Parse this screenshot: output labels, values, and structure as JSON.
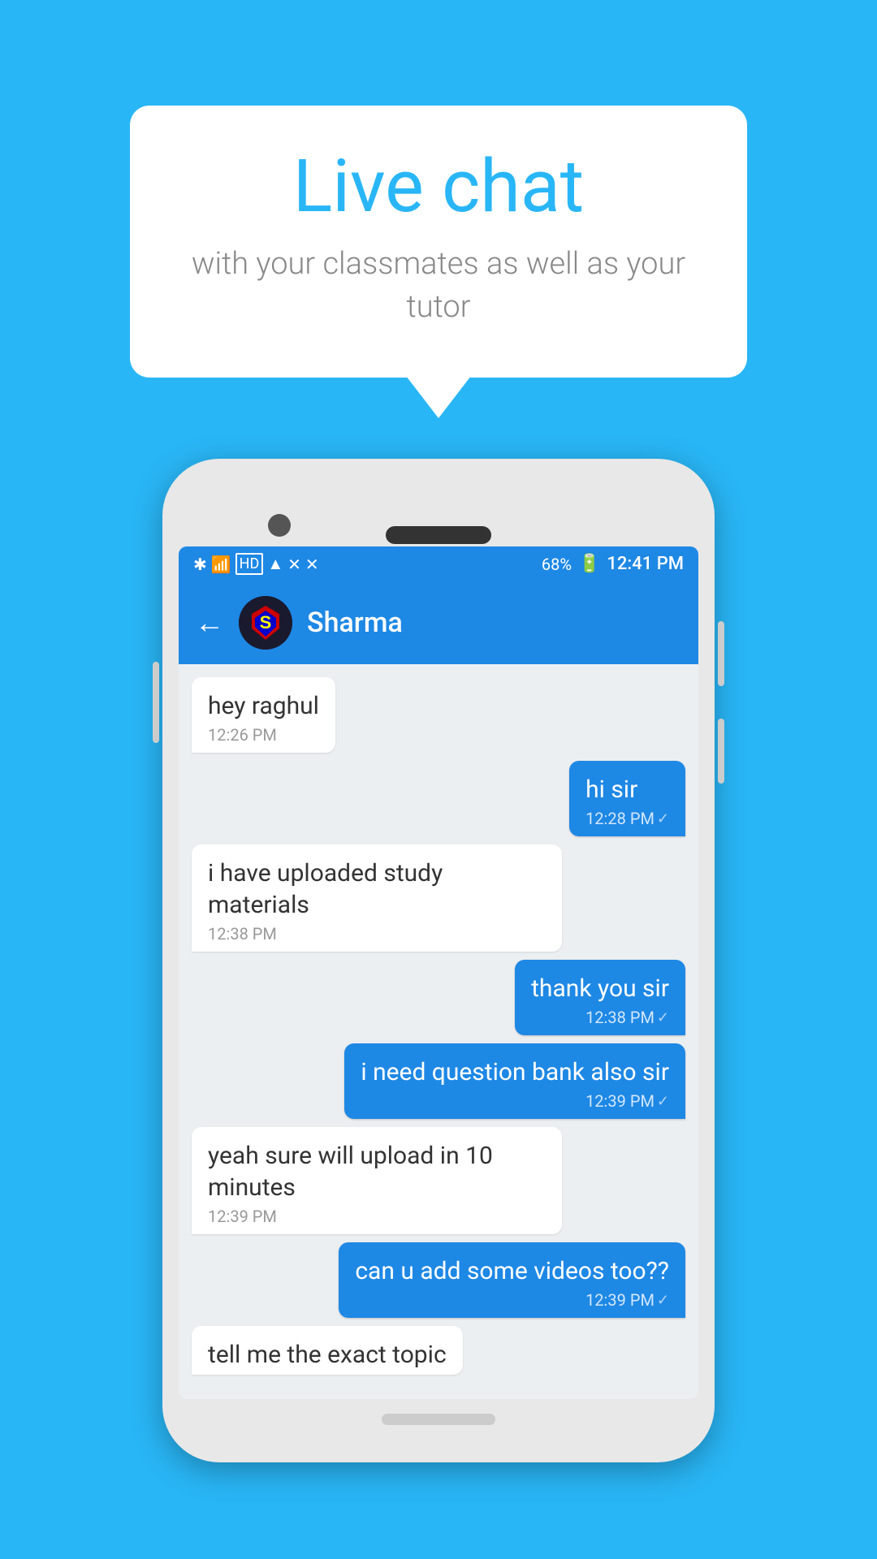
{
  "background_color": "#29b6f6",
  "bubble": {
    "title": "Live chat",
    "subtitle": "with your classmates as well as your tutor"
  },
  "phone": {
    "status_bar": {
      "left_icons": "bluetooth wifi hd signal",
      "battery_text": "68%",
      "time": "12:41 PM"
    },
    "chat_header": {
      "contact_name": "Sharma",
      "back_label": "←"
    },
    "messages": [
      {
        "type": "received",
        "text": "hey raghul",
        "time": "12:26 PM",
        "check": false
      },
      {
        "type": "sent",
        "text": "hi sir",
        "time": "12:28 PM",
        "check": true
      },
      {
        "type": "received",
        "text": "i have uploaded study materials",
        "time": "12:38 PM",
        "check": false
      },
      {
        "type": "sent",
        "text": "thank you sir",
        "time": "12:38 PM",
        "check": true
      },
      {
        "type": "sent",
        "text": "i need question bank also sir",
        "time": "12:39 PM",
        "check": true
      },
      {
        "type": "received",
        "text": "yeah sure will upload in 10 minutes",
        "time": "12:39 PM",
        "check": false
      },
      {
        "type": "sent",
        "text": "can u add some videos too??",
        "time": "12:39 PM",
        "check": true
      },
      {
        "type": "received",
        "text": "tell me the exact topic",
        "time": "",
        "check": false,
        "partial": true
      }
    ]
  }
}
